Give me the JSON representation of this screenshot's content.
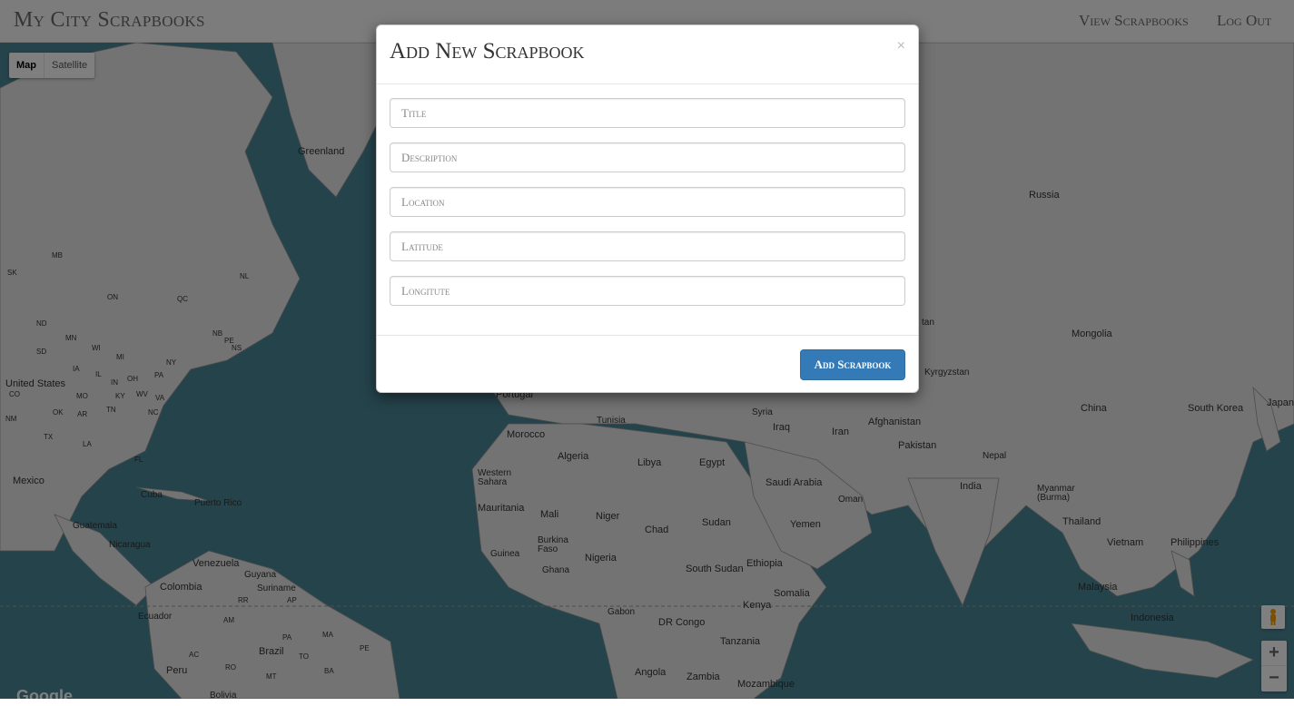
{
  "navbar": {
    "brand": "My City Scrapbooks",
    "links": [
      "View Scrapbooks",
      "Log Out"
    ]
  },
  "map": {
    "map_types": [
      "Map",
      "Satellite"
    ],
    "active_map_type": "Map",
    "zoom_in": "+",
    "zoom_out": "−",
    "logo": "Google",
    "labels": {
      "greenland": "Greenland",
      "russia": "Russia",
      "mongolia": "Mongolia",
      "china": "China",
      "south_korea": "South Korea",
      "japan": "Japan",
      "kyrgyzstan": "Kyrgyzstan",
      "tan": "tan",
      "afghanistan": "Afghanistan",
      "pakistan": "Pakistan",
      "iran": "Iran",
      "iraq": "Iraq",
      "syria": "Syria",
      "nepal": "Nepal",
      "india": "India",
      "myanmar": "Myanmar\n(Burma)",
      "thailand": "Thailand",
      "vietnam": "Vietnam",
      "philippines": "Philippines",
      "malaysia": "Malaysia",
      "indonesia": "Indonesia",
      "saudi_arabia": "Saudi Arabia",
      "oman": "Oman",
      "yemen": "Yemen",
      "egypt": "Egypt",
      "libya": "Libya",
      "tunisia": "Tunisia",
      "algeria": "Algeria",
      "morocco": "Morocco",
      "portugal": "Portugal",
      "western_sahara": "Western\nSahara",
      "mauritania": "Mauritania",
      "mali": "Mali",
      "niger": "Niger",
      "chad": "Chad",
      "sudan": "Sudan",
      "south_sudan": "South Sudan",
      "ethiopia": "Ethiopia",
      "somalia": "Somalia",
      "kenya": "Kenya",
      "tanzania": "Tanzania",
      "nigeria": "Nigeria",
      "burkina_faso": "Burkina\nFaso",
      "guinea": "Guinea",
      "ghana": "Ghana",
      "gabon": "Gabon",
      "dr_congo": "DR Congo",
      "angola": "Angola",
      "zambia": "Zambia",
      "mozambique": "Mozambique",
      "united_states": "United States",
      "mexico": "Mexico",
      "cuba": "Cuba",
      "puerto_rico": "Puerto Rico",
      "guatemala": "Guatemala",
      "nicaragua": "Nicaragua",
      "venezuela": "Venezuela",
      "colombia": "Colombia",
      "guyana": "Guyana",
      "suriname": "Suriname",
      "ecuador": "Ecuador",
      "peru": "Peru",
      "brazil": "Brazil",
      "bolivia": "Bolivia",
      "sk": "SK",
      "mb": "MB",
      "on": "ON",
      "qc": "QC",
      "nl": "NL",
      "nb": "NB",
      "ns": "NS",
      "pe": "PE",
      "nd": "ND",
      "mn": "MN",
      "sd": "SD",
      "wi": "WI",
      "mi": "MI",
      "ia": "IA",
      "il": "IL",
      "in": "IN",
      "oh": "OH",
      "pa": "PA",
      "ny": "NY",
      "co": "CO",
      "mo": "MO",
      "ky": "KY",
      "wv": "WV",
      "va": "VA",
      "ok": "OK",
      "ar": "AR",
      "tn": "TN",
      "nc": "NC",
      "nm": "NM",
      "tx": "TX",
      "la": "LA",
      "fl": "FL",
      "rr": "RR",
      "ap": "AP",
      "am": "AM",
      "pa_br": "PA",
      "ac": "AC",
      "mt": "MT",
      "ba": "BA",
      "ro": "RO",
      "to": "TO",
      "pe_br": "PE",
      "ma": "MA"
    }
  },
  "modal": {
    "title": "Add New Scrapbook",
    "close": "×",
    "fields": {
      "title": "Title",
      "description": "Description",
      "location": "Location",
      "latitude": "Latitude",
      "longitude": "Longitute"
    },
    "submit": "Add Scrapbook"
  },
  "colors": {
    "water": "#4a8696",
    "land": "#e6e6e6",
    "primary": "#337ab7"
  }
}
